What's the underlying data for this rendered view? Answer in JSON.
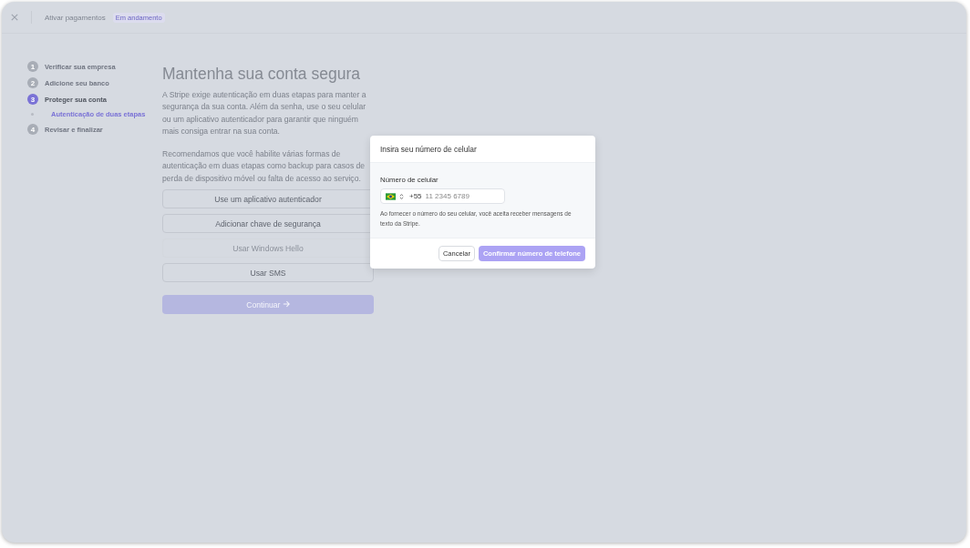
{
  "header": {
    "title": "Ativar pagamentos",
    "badge": "Em andamento"
  },
  "steps": [
    {
      "number": "1",
      "label": "Verificar sua empresa",
      "selected": false
    },
    {
      "number": "2",
      "label": "Adicione seu banco",
      "selected": false
    },
    {
      "number": "3",
      "label": "Proteger sua conta",
      "selected": true,
      "children": [
        {
          "label": "Autenticação de duas etapas",
          "selected": true
        }
      ]
    },
    {
      "number": "4",
      "label": "Revisar e finalizar",
      "selected": false
    }
  ],
  "main": {
    "title": "Mantenha sua conta segura",
    "paragraphs": [
      "A Stripe exige autenticação em duas etapas para manter a segurança da sua conta. Além da senha, use o seu celular ou um aplicativo autenticador para garantir que ninguém mais consiga entrar na sua conta.",
      "Recomendamos que você habilite várias formas de autenticação em duas etapas como backup para casos de perda de dispositivo móvel ou falta de acesso ao serviço."
    ],
    "methods": [
      {
        "label": "Use um aplicativo autenticador",
        "disabled": false
      },
      {
        "label": "Adicionar chave de segurança",
        "disabled": false
      },
      {
        "label": "Usar Windows Hello",
        "disabled": true
      },
      {
        "label": "Usar SMS",
        "disabled": false
      }
    ],
    "continue": {
      "label": "Continuar",
      "disabled": true
    }
  },
  "dialog": {
    "title": "Insira seu número de celular",
    "field_label": "Número de celular",
    "country_code": "+55",
    "placeholder": "11 2345 6789",
    "note": "Ao fornecer o número do seu celular, você aceita receber mensagens de texto da Stripe.",
    "cancel": "Cancelar",
    "confirm": "Confirmar número de telefone"
  }
}
